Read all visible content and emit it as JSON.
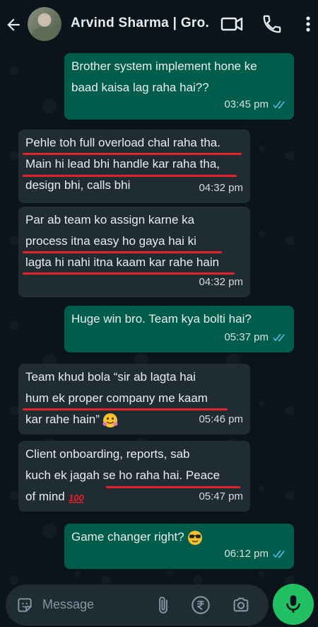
{
  "header": {
    "contact_name": "Arvind  Sharma  | Gro."
  },
  "messages": [
    {
      "dir": "out",
      "text": "Brother system implement hone ke\nbaad kaisa lag raha hai??",
      "time": "03:45 pm"
    },
    {
      "dir": "in",
      "text": "Pehle toh full overload chal raha tha.\nMain hi lead bhi handle kar raha tha,\ndesign bhi, calls bhi",
      "time": "04:32 pm"
    },
    {
      "dir": "in",
      "text": "Par ab team ko assign karne ka\nprocess itna easy ho gaya hai ki\nlagta hi nahi itna kaam kar rahe hain",
      "time": "04:32 pm"
    },
    {
      "dir": "out",
      "text": "Huge win bro. Team kya bolti hai?",
      "time": "05:37 pm"
    },
    {
      "dir": "in",
      "text": "Team khud bola “sir ab lagta hai\nhum ek proper company me kaam\nkar rahe hain”",
      "time": "05:46 pm"
    },
    {
      "dir": "in",
      "text": "Client onboarding, reports, sab\nkuch ek jagah se ho raha hai. Peace\nof mind",
      "time": "05:47 pm"
    },
    {
      "dir": "out",
      "text": "Game changer right?",
      "time": "06:12 pm"
    }
  ],
  "composer": {
    "placeholder": "Message"
  },
  "colors": {
    "outgoing_bubble": "#005c4b",
    "incoming_bubble": "#202c33",
    "read_ticks": "#53bdeb",
    "underline": "#e8202a",
    "mic_button": "#21c063"
  }
}
